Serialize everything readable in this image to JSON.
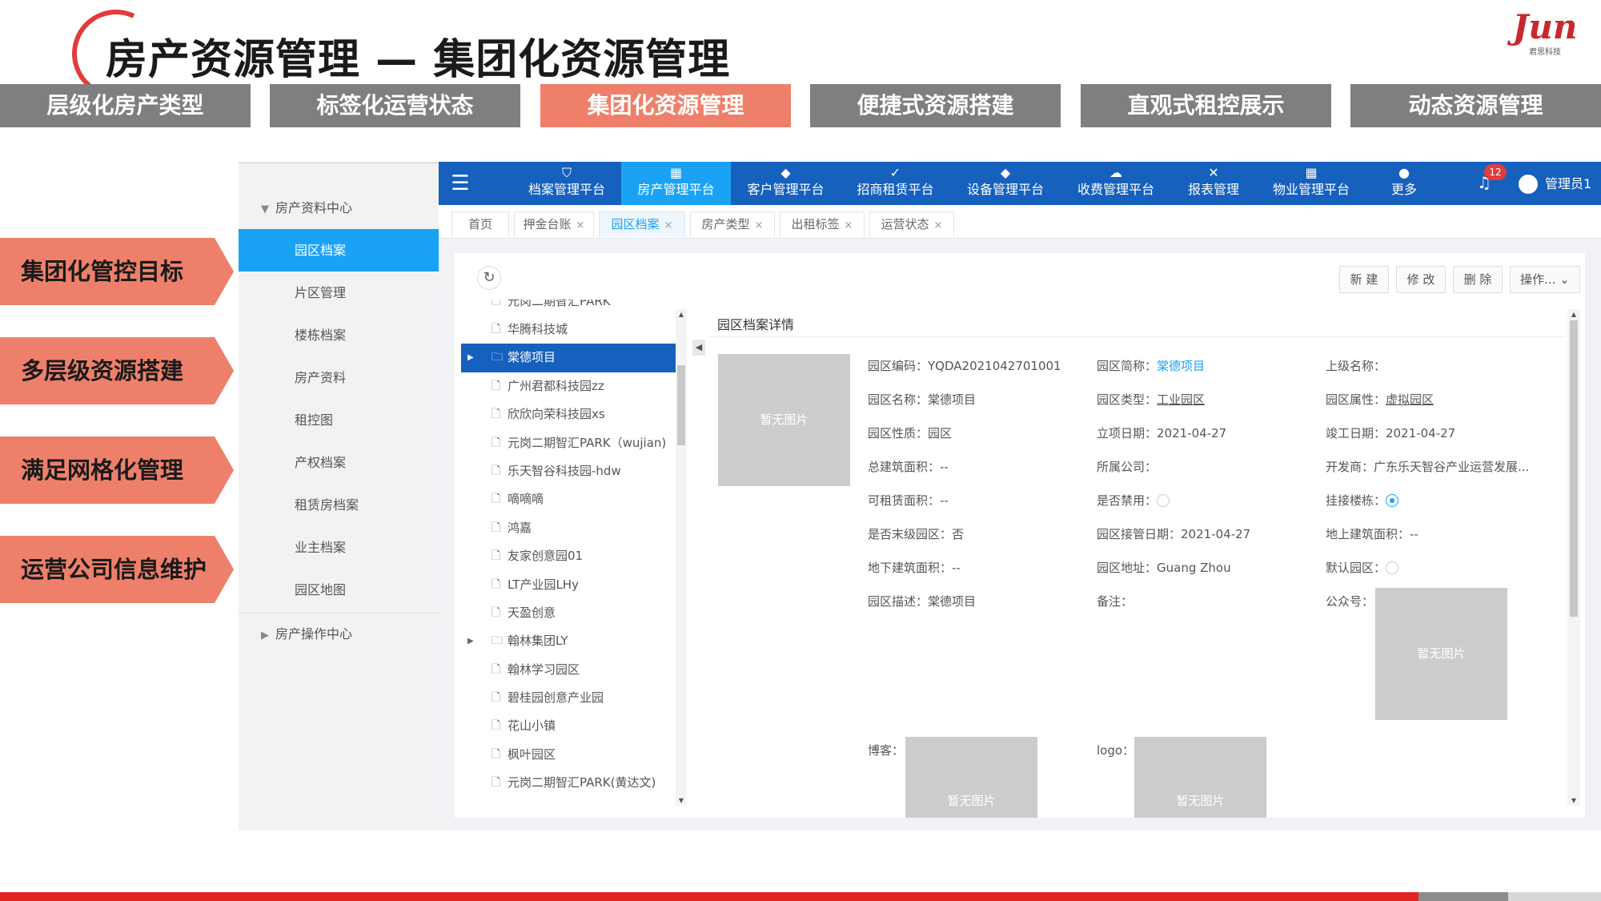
{
  "slide": {
    "title": "房产资源管理 — 集团化资源管理",
    "logo_text": "Jun",
    "logo_sub": "君思科技",
    "feature_tabs": [
      {
        "label": "层级化房产类型"
      },
      {
        "label": "标签化运营状态"
      },
      {
        "label": "集团化资源管理"
      },
      {
        "label": "便捷式资源搭建"
      },
      {
        "label": "直观式租控展示"
      },
      {
        "label": "动态资源管理"
      }
    ],
    "active_feature": "集团化资源管理",
    "side_labels": [
      "集团化管控目标",
      "多层级资源搭建",
      "满足网格化管理",
      "运营公司信息维护"
    ]
  },
  "sidebar": {
    "group1": "房产资料中心",
    "items": [
      {
        "label": "园区档案"
      },
      {
        "label": "片区管理"
      },
      {
        "label": "楼栋档案"
      },
      {
        "label": "房产资料"
      },
      {
        "label": "租控图"
      },
      {
        "label": "产权档案"
      },
      {
        "label": "租赁房档案"
      },
      {
        "label": "业主档案"
      },
      {
        "label": "园区地图"
      }
    ],
    "active_item": "园区档案",
    "group2": "房产操作中心"
  },
  "topnav": {
    "items": [
      {
        "label": "档案管理平台",
        "icon": "shield-icon"
      },
      {
        "label": "房产管理平台",
        "icon": "building-icon"
      },
      {
        "label": "客户管理平台",
        "icon": "handshake-icon"
      },
      {
        "label": "招商租赁平台",
        "icon": "check-icon"
      },
      {
        "label": "设备管理平台",
        "icon": "wrench-icon"
      },
      {
        "label": "收费管理平台",
        "icon": "coin-icon"
      },
      {
        "label": "报表管理",
        "icon": "chart-icon"
      },
      {
        "label": "物业管理平台",
        "icon": "office-icon"
      },
      {
        "label": "更多",
        "icon": "more-icon"
      }
    ],
    "active": "房产管理平台",
    "notifications": "12",
    "user": "管理员1"
  },
  "tabs": [
    {
      "label": "首页",
      "closable": false
    },
    {
      "label": "押金台账",
      "closable": true
    },
    {
      "label": "园区档案",
      "closable": true
    },
    {
      "label": "房产类型",
      "closable": true
    },
    {
      "label": "出租标签",
      "closable": true
    },
    {
      "label": "运营状态",
      "closable": true
    }
  ],
  "active_tab": "园区档案",
  "actions": [
    "新 建",
    "修 改",
    "删 除",
    "操作..."
  ],
  "tree": [
    {
      "label": "元岗二期智汇PARK",
      "type": "file"
    },
    {
      "label": "华腾科技城",
      "type": "file"
    },
    {
      "label": "棠德项目",
      "type": "folder",
      "expandable": true,
      "selected": true
    },
    {
      "label": "广州君都科技园zz",
      "type": "file"
    },
    {
      "label": "欣欣向荣科技园xs",
      "type": "file"
    },
    {
      "label": "元岗二期智汇PARK（wujian)",
      "type": "file"
    },
    {
      "label": "乐天智谷科技园-hdw",
      "type": "file"
    },
    {
      "label": "嘀嘀嘀",
      "type": "file"
    },
    {
      "label": "鸿嘉",
      "type": "file"
    },
    {
      "label": "友家创意园01",
      "type": "file"
    },
    {
      "label": "LT产业园LHy",
      "type": "file"
    },
    {
      "label": "天盈创意",
      "type": "file"
    },
    {
      "label": "翰林集团LY",
      "type": "folder",
      "expandable": true
    },
    {
      "label": "翰林学习园区",
      "type": "file"
    },
    {
      "label": "碧桂园创意产业园",
      "type": "file"
    },
    {
      "label": "花山小镇",
      "type": "file"
    },
    {
      "label": "枫叶园区",
      "type": "file"
    },
    {
      "label": "元岗二期智汇PARK(黄达文)",
      "type": "file"
    }
  ],
  "detail": {
    "title": "园区档案详情",
    "no_image": "暂无图片",
    "fields": [
      {
        "label": "园区编码：",
        "value": "YQDA2021042701001"
      },
      {
        "label": "园区简称：",
        "value": "棠德项目",
        "link": true
      },
      {
        "label": "上级名称：",
        "value": ""
      },
      {
        "label": "园区名称：",
        "value": "棠德项目"
      },
      {
        "label": "园区类型：",
        "value": "工业园区",
        "underline": true
      },
      {
        "label": "园区属性：",
        "value": "虚拟园区",
        "underline": true
      },
      {
        "label": "园区性质：",
        "value": "园区"
      },
      {
        "label": "立项日期：",
        "value": "2021-04-27"
      },
      {
        "label": "竣工日期：",
        "value": "2021-04-27"
      },
      {
        "label": "总建筑面积：",
        "value": "--"
      },
      {
        "label": "所属公司：",
        "value": ""
      },
      {
        "label": "开发商：",
        "value": "广东乐天智谷产业运营发展..."
      },
      {
        "label": "可租赁面积：",
        "value": "--"
      },
      {
        "label": "是否禁用：",
        "radio": false
      },
      {
        "label": "挂接楼栋：",
        "radio": true
      },
      {
        "label": "是否末级园区：",
        "value": "否"
      },
      {
        "label": "园区接管日期：",
        "value": "2021-04-27"
      },
      {
        "label": "地上建筑面积：",
        "value": "--"
      },
      {
        "label": "地下建筑面积：",
        "value": "--"
      },
      {
        "label": "园区地址：",
        "value": "Guang Zhou"
      },
      {
        "label": "默认园区：",
        "radio": false
      },
      {
        "label": "园区描述：",
        "value": "棠德项目"
      },
      {
        "label": "备注：",
        "value": ""
      },
      {
        "label": "公众号：",
        "value": ""
      }
    ],
    "blog_label": "博客：",
    "logo_label": "logo："
  },
  "colors": {
    "accent_orange": "#ee806b",
    "nav_blue": "#1660be",
    "active_blue": "#1aa3f5",
    "bottom_red": "#e02420"
  }
}
